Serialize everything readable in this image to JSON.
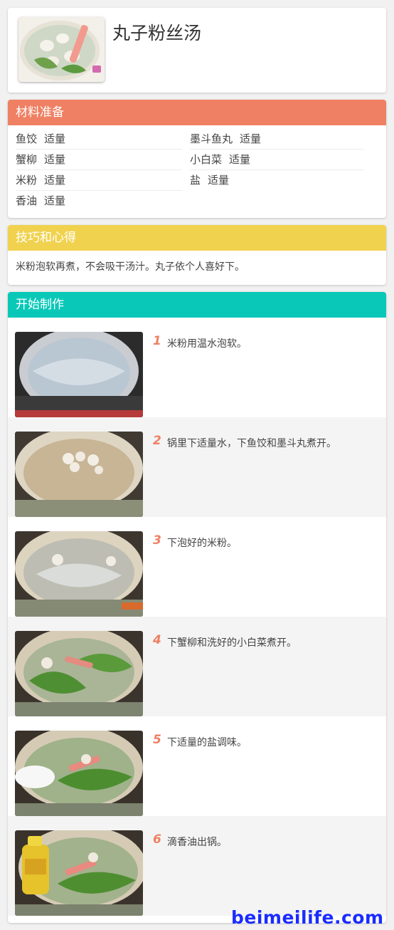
{
  "recipe": {
    "title": "丸子粉丝汤"
  },
  "ingredients": {
    "heading": "材料准备",
    "items": [
      {
        "name": "鱼饺",
        "qty": "适量"
      },
      {
        "name": "墨斗鱼丸",
        "qty": "适量"
      },
      {
        "name": "蟹柳",
        "qty": "适量"
      },
      {
        "name": "小白菜",
        "qty": "适量"
      },
      {
        "name": "米粉",
        "qty": "适量"
      },
      {
        "name": "盐",
        "qty": "适量"
      },
      {
        "name": "香油",
        "qty": "适量"
      }
    ]
  },
  "tips": {
    "heading": "技巧和心得",
    "text": "米粉泡软再煮，不会吸干汤汁。丸子依个人喜好下。"
  },
  "steps": {
    "heading": "开始制作",
    "items": [
      {
        "num": "1",
        "text": "米粉用温水泡软。"
      },
      {
        "num": "2",
        "text": "锅里下适量水，下鱼饺和墨斗丸煮开。"
      },
      {
        "num": "3",
        "text": "下泡好的米粉。"
      },
      {
        "num": "4",
        "text": "下蟹柳和洗好的小白菜煮开。"
      },
      {
        "num": "5",
        "text": "下适量的盐调味。"
      },
      {
        "num": "6",
        "text": "滴香油出锅。"
      }
    ]
  },
  "watermark": "beimeilife.com",
  "colors": {
    "ingredients_header": "#ef8063",
    "tips_header": "#f0d24f",
    "steps_header": "#0ac8b8",
    "step_number": "#ef8063",
    "watermark": "#1a2cff"
  }
}
